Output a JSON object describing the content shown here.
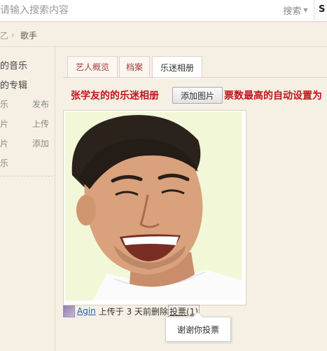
{
  "search": {
    "placeholder": "请输入搜索内容",
    "button_label": "搜索",
    "extra_glyph": "S"
  },
  "breadcrumb": {
    "parent_fragment": "乙",
    "current": "歌手"
  },
  "sidebar": {
    "items": [
      "的音乐",
      "的专辑"
    ],
    "rows": [
      {
        "label": "乐",
        "value": "发布"
      },
      {
        "label": "片",
        "value": "上传"
      },
      {
        "label": "片",
        "value": "添加"
      },
      {
        "label": "乐",
        "value": ""
      }
    ]
  },
  "tabs": [
    {
      "label": "艺人概览"
    },
    {
      "label": "档案"
    },
    {
      "label": "乐迷相册",
      "active": true
    }
  ],
  "album": {
    "title": "张学友的的乐迷相册",
    "add_button": "添加图片",
    "note": "票数最高的自动设置为"
  },
  "upload": {
    "user": "Agin",
    "text": "上传于 3 天前",
    "delete": "删除",
    "vote": "投票(1)"
  },
  "tooltip": {
    "text": "谢谢你投票"
  },
  "colors": {
    "accent_red": "#c0141c",
    "link_blue": "#1a5fb4",
    "background": "#f6f0e4",
    "photo_bg": "#f2f7d8"
  }
}
